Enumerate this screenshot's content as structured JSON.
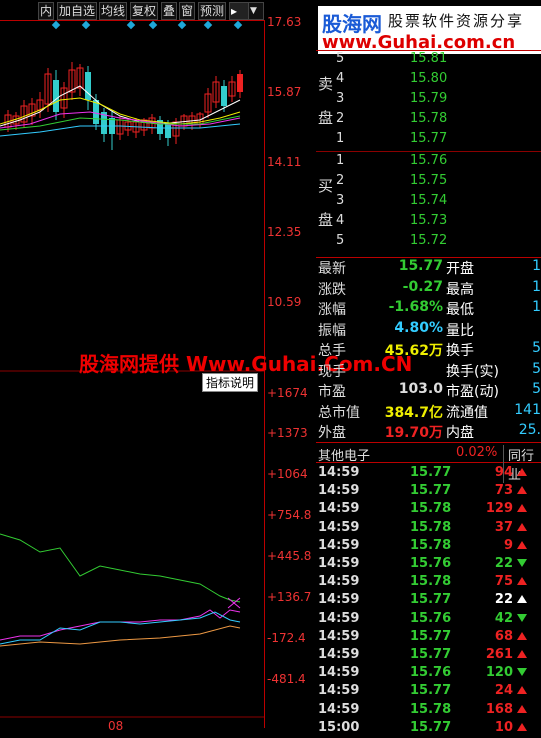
{
  "toolbar": {
    "items": [
      "内",
      "加自选",
      "均线",
      "复权",
      "叠",
      "窗",
      "预测"
    ],
    "extra": "▸"
  },
  "price_axis": [
    "17.63",
    "15.87",
    "14.11",
    "12.35",
    "10.59"
  ],
  "indicator_axis": [
    "+1674",
    "+1373",
    "+1064",
    "+754.8",
    "+445.8",
    "+136.7",
    "-172.4",
    "-481.4"
  ],
  "date_label": "08",
  "indicator_button": "指标说明",
  "watermark": "股海网提供 Www.Guhai.Com.CN",
  "logo": {
    "main": "股海网",
    "sub": "股票软件资源分享",
    "url": "www.Guhai.com.cn"
  },
  "order_book": {
    "sell_label_1": "卖",
    "sell_label_2": "盘",
    "buy_label_1": "买",
    "buy_label_2": "盘",
    "sells": [
      {
        "lvl": "5",
        "price": "15.81"
      },
      {
        "lvl": "4",
        "price": "15.80"
      },
      {
        "lvl": "3",
        "price": "15.79"
      },
      {
        "lvl": "2",
        "price": "15.78"
      },
      {
        "lvl": "1",
        "price": "15.77"
      }
    ],
    "buys": [
      {
        "lvl": "1",
        "price": "15.76"
      },
      {
        "lvl": "2",
        "price": "15.75"
      },
      {
        "lvl": "3",
        "price": "15.74"
      },
      {
        "lvl": "4",
        "price": "15.73"
      },
      {
        "lvl": "5",
        "price": "15.72"
      }
    ]
  },
  "quote": {
    "rows": [
      {
        "l": "最新",
        "v": "15.77",
        "r": "开盘",
        "rc": "#fff",
        "vc": "#3c3"
      },
      {
        "l": "涨跌",
        "v": "-0.27",
        "r": "最高",
        "rc": "#fff",
        "vc": "#3c3"
      },
      {
        "l": "涨幅",
        "v": "-1.68%",
        "r": "最低",
        "rc": "#fff",
        "vc": "#3c3"
      },
      {
        "l": "振幅",
        "v": "4.80%",
        "r": "量比",
        "rc": "#fff",
        "vc": "#3cf"
      },
      {
        "l": "总手",
        "v": "45.62万",
        "r": "换手",
        "rc": "#fff",
        "vc": "#ee0"
      },
      {
        "l": "现手",
        "v": "",
        "r": "换手(实)",
        "rc": "#fff",
        "vc": "#ee0"
      },
      {
        "l": "市盈",
        "v": "103.0",
        "r": "市盈(动)",
        "rc": "#fff",
        "vc": "#ddd"
      },
      {
        "l": "总市值",
        "v": "384.7亿",
        "r": "流通值",
        "rc": "#fff",
        "vc": "#ee0"
      },
      {
        "l": "外盘",
        "v": "19.70万",
        "r": "内盘",
        "rc": "#fff",
        "vc": "#e22"
      }
    ],
    "right_values": [
      "1",
      "1",
      "1",
      "",
      "5",
      "5",
      "5",
      "141",
      "25."
    ]
  },
  "sector": {
    "name": "其他电子",
    "pct": "0.02%",
    "tab": "同行业"
  },
  "ticks": [
    {
      "t": "14:59",
      "p": "15.77",
      "v": "94",
      "d": "up"
    },
    {
      "t": "14:59",
      "p": "15.77",
      "v": "73",
      "d": "up"
    },
    {
      "t": "14:59",
      "p": "15.78",
      "v": "129",
      "d": "up"
    },
    {
      "t": "14:59",
      "p": "15.78",
      "v": "37",
      "d": "up"
    },
    {
      "t": "14:59",
      "p": "15.78",
      "v": "9",
      "d": "up"
    },
    {
      "t": "14:59",
      "p": "15.76",
      "v": "22",
      "d": "down"
    },
    {
      "t": "14:59",
      "p": "15.78",
      "v": "75",
      "d": "up"
    },
    {
      "t": "14:59",
      "p": "15.77",
      "v": "22",
      "d": "neutral"
    },
    {
      "t": "14:59",
      "p": "15.76",
      "v": "42",
      "d": "down"
    },
    {
      "t": "14:59",
      "p": "15.77",
      "v": "68",
      "d": "up"
    },
    {
      "t": "14:59",
      "p": "15.77",
      "v": "261",
      "d": "up"
    },
    {
      "t": "14:59",
      "p": "15.76",
      "v": "120",
      "d": "down"
    },
    {
      "t": "14:59",
      "p": "15.77",
      "v": "24",
      "d": "up"
    },
    {
      "t": "14:59",
      "p": "15.78",
      "v": "168",
      "d": "up"
    },
    {
      "t": "15:00",
      "p": "15.77",
      "v": "10",
      "d": "up"
    }
  ],
  "colors": {
    "up": "#e22",
    "down": "#3c3",
    "neutral": "#fff",
    "accent": "#1a5bd6"
  }
}
